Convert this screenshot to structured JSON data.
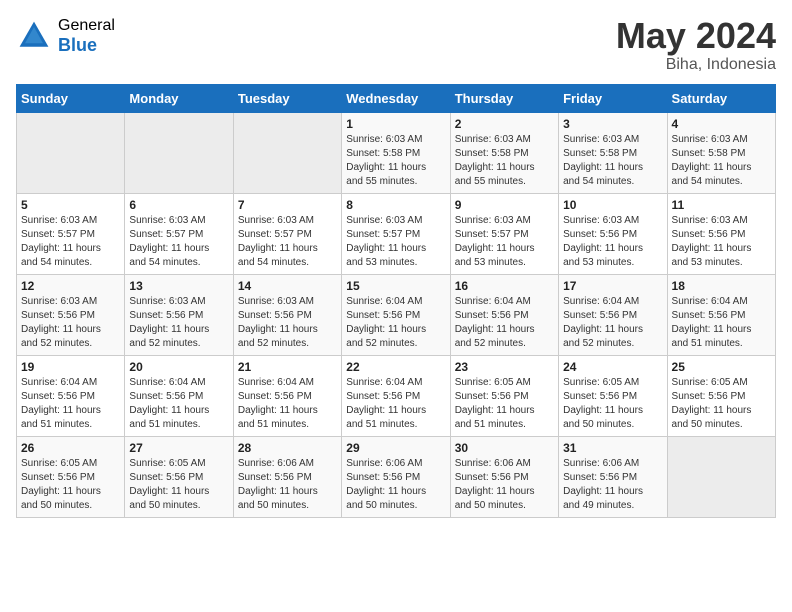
{
  "header": {
    "logo_general": "General",
    "logo_blue": "Blue",
    "month_year": "May 2024",
    "location": "Biha, Indonesia"
  },
  "calendar": {
    "days_of_week": [
      "Sunday",
      "Monday",
      "Tuesday",
      "Wednesday",
      "Thursday",
      "Friday",
      "Saturday"
    ],
    "weeks": [
      [
        {
          "day": "",
          "info": ""
        },
        {
          "day": "",
          "info": ""
        },
        {
          "day": "",
          "info": ""
        },
        {
          "day": "1",
          "info": "Sunrise: 6:03 AM\nSunset: 5:58 PM\nDaylight: 11 hours\nand 55 minutes."
        },
        {
          "day": "2",
          "info": "Sunrise: 6:03 AM\nSunset: 5:58 PM\nDaylight: 11 hours\nand 55 minutes."
        },
        {
          "day": "3",
          "info": "Sunrise: 6:03 AM\nSunset: 5:58 PM\nDaylight: 11 hours\nand 54 minutes."
        },
        {
          "day": "4",
          "info": "Sunrise: 6:03 AM\nSunset: 5:58 PM\nDaylight: 11 hours\nand 54 minutes."
        }
      ],
      [
        {
          "day": "5",
          "info": "Sunrise: 6:03 AM\nSunset: 5:57 PM\nDaylight: 11 hours\nand 54 minutes."
        },
        {
          "day": "6",
          "info": "Sunrise: 6:03 AM\nSunset: 5:57 PM\nDaylight: 11 hours\nand 54 minutes."
        },
        {
          "day": "7",
          "info": "Sunrise: 6:03 AM\nSunset: 5:57 PM\nDaylight: 11 hours\nand 54 minutes."
        },
        {
          "day": "8",
          "info": "Sunrise: 6:03 AM\nSunset: 5:57 PM\nDaylight: 11 hours\nand 53 minutes."
        },
        {
          "day": "9",
          "info": "Sunrise: 6:03 AM\nSunset: 5:57 PM\nDaylight: 11 hours\nand 53 minutes."
        },
        {
          "day": "10",
          "info": "Sunrise: 6:03 AM\nSunset: 5:56 PM\nDaylight: 11 hours\nand 53 minutes."
        },
        {
          "day": "11",
          "info": "Sunrise: 6:03 AM\nSunset: 5:56 PM\nDaylight: 11 hours\nand 53 minutes."
        }
      ],
      [
        {
          "day": "12",
          "info": "Sunrise: 6:03 AM\nSunset: 5:56 PM\nDaylight: 11 hours\nand 52 minutes."
        },
        {
          "day": "13",
          "info": "Sunrise: 6:03 AM\nSunset: 5:56 PM\nDaylight: 11 hours\nand 52 minutes."
        },
        {
          "day": "14",
          "info": "Sunrise: 6:03 AM\nSunset: 5:56 PM\nDaylight: 11 hours\nand 52 minutes."
        },
        {
          "day": "15",
          "info": "Sunrise: 6:04 AM\nSunset: 5:56 PM\nDaylight: 11 hours\nand 52 minutes."
        },
        {
          "day": "16",
          "info": "Sunrise: 6:04 AM\nSunset: 5:56 PM\nDaylight: 11 hours\nand 52 minutes."
        },
        {
          "day": "17",
          "info": "Sunrise: 6:04 AM\nSunset: 5:56 PM\nDaylight: 11 hours\nand 52 minutes."
        },
        {
          "day": "18",
          "info": "Sunrise: 6:04 AM\nSunset: 5:56 PM\nDaylight: 11 hours\nand 51 minutes."
        }
      ],
      [
        {
          "day": "19",
          "info": "Sunrise: 6:04 AM\nSunset: 5:56 PM\nDaylight: 11 hours\nand 51 minutes."
        },
        {
          "day": "20",
          "info": "Sunrise: 6:04 AM\nSunset: 5:56 PM\nDaylight: 11 hours\nand 51 minutes."
        },
        {
          "day": "21",
          "info": "Sunrise: 6:04 AM\nSunset: 5:56 PM\nDaylight: 11 hours\nand 51 minutes."
        },
        {
          "day": "22",
          "info": "Sunrise: 6:04 AM\nSunset: 5:56 PM\nDaylight: 11 hours\nand 51 minutes."
        },
        {
          "day": "23",
          "info": "Sunrise: 6:05 AM\nSunset: 5:56 PM\nDaylight: 11 hours\nand 51 minutes."
        },
        {
          "day": "24",
          "info": "Sunrise: 6:05 AM\nSunset: 5:56 PM\nDaylight: 11 hours\nand 50 minutes."
        },
        {
          "day": "25",
          "info": "Sunrise: 6:05 AM\nSunset: 5:56 PM\nDaylight: 11 hours\nand 50 minutes."
        }
      ],
      [
        {
          "day": "26",
          "info": "Sunrise: 6:05 AM\nSunset: 5:56 PM\nDaylight: 11 hours\nand 50 minutes."
        },
        {
          "day": "27",
          "info": "Sunrise: 6:05 AM\nSunset: 5:56 PM\nDaylight: 11 hours\nand 50 minutes."
        },
        {
          "day": "28",
          "info": "Sunrise: 6:06 AM\nSunset: 5:56 PM\nDaylight: 11 hours\nand 50 minutes."
        },
        {
          "day": "29",
          "info": "Sunrise: 6:06 AM\nSunset: 5:56 PM\nDaylight: 11 hours\nand 50 minutes."
        },
        {
          "day": "30",
          "info": "Sunrise: 6:06 AM\nSunset: 5:56 PM\nDaylight: 11 hours\nand 50 minutes."
        },
        {
          "day": "31",
          "info": "Sunrise: 6:06 AM\nSunset: 5:56 PM\nDaylight: 11 hours\nand 49 minutes."
        },
        {
          "day": "",
          "info": ""
        }
      ]
    ]
  }
}
